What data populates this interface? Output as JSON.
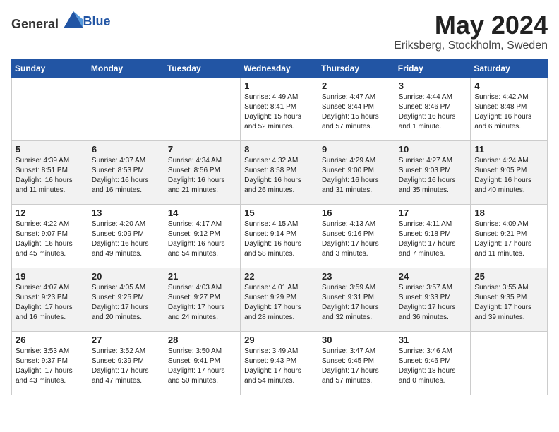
{
  "logo": {
    "general": "General",
    "blue": "Blue"
  },
  "title": {
    "month_year": "May 2024",
    "location": "Eriksberg, Stockholm, Sweden"
  },
  "headers": [
    "Sunday",
    "Monday",
    "Tuesday",
    "Wednesday",
    "Thursday",
    "Friday",
    "Saturday"
  ],
  "weeks": [
    [
      {
        "day": "",
        "info": ""
      },
      {
        "day": "",
        "info": ""
      },
      {
        "day": "",
        "info": ""
      },
      {
        "day": "1",
        "info": "Sunrise: 4:49 AM\nSunset: 8:41 PM\nDaylight: 15 hours\nand 52 minutes."
      },
      {
        "day": "2",
        "info": "Sunrise: 4:47 AM\nSunset: 8:44 PM\nDaylight: 15 hours\nand 57 minutes."
      },
      {
        "day": "3",
        "info": "Sunrise: 4:44 AM\nSunset: 8:46 PM\nDaylight: 16 hours\nand 1 minute."
      },
      {
        "day": "4",
        "info": "Sunrise: 4:42 AM\nSunset: 8:48 PM\nDaylight: 16 hours\nand 6 minutes."
      }
    ],
    [
      {
        "day": "5",
        "info": "Sunrise: 4:39 AM\nSunset: 8:51 PM\nDaylight: 16 hours\nand 11 minutes."
      },
      {
        "day": "6",
        "info": "Sunrise: 4:37 AM\nSunset: 8:53 PM\nDaylight: 16 hours\nand 16 minutes."
      },
      {
        "day": "7",
        "info": "Sunrise: 4:34 AM\nSunset: 8:56 PM\nDaylight: 16 hours\nand 21 minutes."
      },
      {
        "day": "8",
        "info": "Sunrise: 4:32 AM\nSunset: 8:58 PM\nDaylight: 16 hours\nand 26 minutes."
      },
      {
        "day": "9",
        "info": "Sunrise: 4:29 AM\nSunset: 9:00 PM\nDaylight: 16 hours\nand 31 minutes."
      },
      {
        "day": "10",
        "info": "Sunrise: 4:27 AM\nSunset: 9:03 PM\nDaylight: 16 hours\nand 35 minutes."
      },
      {
        "day": "11",
        "info": "Sunrise: 4:24 AM\nSunset: 9:05 PM\nDaylight: 16 hours\nand 40 minutes."
      }
    ],
    [
      {
        "day": "12",
        "info": "Sunrise: 4:22 AM\nSunset: 9:07 PM\nDaylight: 16 hours\nand 45 minutes."
      },
      {
        "day": "13",
        "info": "Sunrise: 4:20 AM\nSunset: 9:09 PM\nDaylight: 16 hours\nand 49 minutes."
      },
      {
        "day": "14",
        "info": "Sunrise: 4:17 AM\nSunset: 9:12 PM\nDaylight: 16 hours\nand 54 minutes."
      },
      {
        "day": "15",
        "info": "Sunrise: 4:15 AM\nSunset: 9:14 PM\nDaylight: 16 hours\nand 58 minutes."
      },
      {
        "day": "16",
        "info": "Sunrise: 4:13 AM\nSunset: 9:16 PM\nDaylight: 17 hours\nand 3 minutes."
      },
      {
        "day": "17",
        "info": "Sunrise: 4:11 AM\nSunset: 9:18 PM\nDaylight: 17 hours\nand 7 minutes."
      },
      {
        "day": "18",
        "info": "Sunrise: 4:09 AM\nSunset: 9:21 PM\nDaylight: 17 hours\nand 11 minutes."
      }
    ],
    [
      {
        "day": "19",
        "info": "Sunrise: 4:07 AM\nSunset: 9:23 PM\nDaylight: 17 hours\nand 16 minutes."
      },
      {
        "day": "20",
        "info": "Sunrise: 4:05 AM\nSunset: 9:25 PM\nDaylight: 17 hours\nand 20 minutes."
      },
      {
        "day": "21",
        "info": "Sunrise: 4:03 AM\nSunset: 9:27 PM\nDaylight: 17 hours\nand 24 minutes."
      },
      {
        "day": "22",
        "info": "Sunrise: 4:01 AM\nSunset: 9:29 PM\nDaylight: 17 hours\nand 28 minutes."
      },
      {
        "day": "23",
        "info": "Sunrise: 3:59 AM\nSunset: 9:31 PM\nDaylight: 17 hours\nand 32 minutes."
      },
      {
        "day": "24",
        "info": "Sunrise: 3:57 AM\nSunset: 9:33 PM\nDaylight: 17 hours\nand 36 minutes."
      },
      {
        "day": "25",
        "info": "Sunrise: 3:55 AM\nSunset: 9:35 PM\nDaylight: 17 hours\nand 39 minutes."
      }
    ],
    [
      {
        "day": "26",
        "info": "Sunrise: 3:53 AM\nSunset: 9:37 PM\nDaylight: 17 hours\nand 43 minutes."
      },
      {
        "day": "27",
        "info": "Sunrise: 3:52 AM\nSunset: 9:39 PM\nDaylight: 17 hours\nand 47 minutes."
      },
      {
        "day": "28",
        "info": "Sunrise: 3:50 AM\nSunset: 9:41 PM\nDaylight: 17 hours\nand 50 minutes."
      },
      {
        "day": "29",
        "info": "Sunrise: 3:49 AM\nSunset: 9:43 PM\nDaylight: 17 hours\nand 54 minutes."
      },
      {
        "day": "30",
        "info": "Sunrise: 3:47 AM\nSunset: 9:45 PM\nDaylight: 17 hours\nand 57 minutes."
      },
      {
        "day": "31",
        "info": "Sunrise: 3:46 AM\nSunset: 9:46 PM\nDaylight: 18 hours\nand 0 minutes."
      },
      {
        "day": "",
        "info": ""
      }
    ]
  ]
}
